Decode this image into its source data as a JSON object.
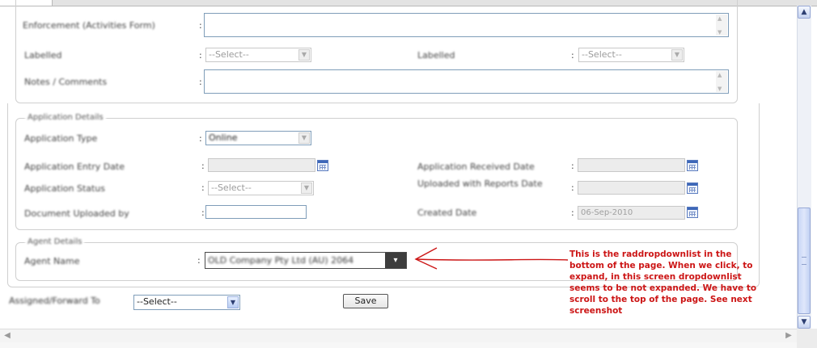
{
  "select_placeholder": "--Select--",
  "section1": {
    "field1_label": "Enforcement (Activities Form)",
    "field2_label": "Labelled",
    "field3_label": "Labelled",
    "field4_label": "Notes / Comments",
    "colon": ":"
  },
  "application_details": {
    "legend": "Application Details",
    "type_label": "Application Type",
    "type_value": "Online",
    "entry_date_label": "Application Entry Date",
    "received_date_label": "Application Received Date",
    "status_label": "Application Status",
    "upload_label": "Uploaded with Reports Date",
    "uploaded_by_label": "Document Uploaded by",
    "date_label": "Created Date",
    "date_value": "06-Sep-2010"
  },
  "agent_section": {
    "legend": "Agent Details",
    "agent_label": "Agent Name",
    "agent_value": "OLD Company Pty Ltd (AU) 2064"
  },
  "annotation": {
    "text": "This is the raddropdownlist in the bottom of the page. When we click, to expand, in this screen dropdownlist seems to be not expanded. We have to scroll to the top of the page. See next screenshot",
    "color": "#cc1515"
  },
  "footer": {
    "assign_label": "Assigned/Forward To",
    "assign_value": "--Select--",
    "save_label": "Save"
  },
  "scrollbar": {
    "up_icon": "▲",
    "down_icon": "▼",
    "left_icon": "◀",
    "right_icon": "▶"
  }
}
